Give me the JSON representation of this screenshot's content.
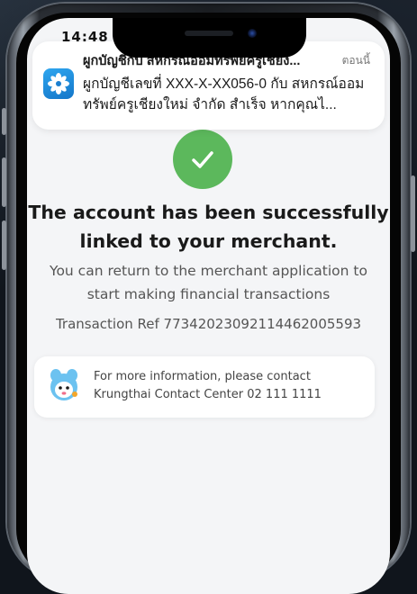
{
  "status_bar": {
    "time": "14:48"
  },
  "notification": {
    "app_icon": "krungthai-app-icon",
    "title": "ผูกบัญชีกับ สหกรณ์ออมทรัพย์ครูเชียง...",
    "time": "ตอนนี้",
    "body": "ผูกบัญชีเลขที่ XXX-X-XX056-0 กับ สหกรณ์ออมทรัพย์ครูเชียงใหม่ จำกัด สำเร็จ หากคุณไ..."
  },
  "success": {
    "icon": "checkmark-icon",
    "headline_line1": "The account has been successfully",
    "headline_line2": "linked to your merchant.",
    "subtext_line1": "You can return to the merchant application to",
    "subtext_line2": "start making financial transactions",
    "transaction_ref": "Transaction Ref 7734202309211446200559​3"
  },
  "contact": {
    "icon": "mascot-icon",
    "line1": "For more information, please contact",
    "line2": "Krungthai Contact Center 02 111 1111"
  },
  "colors": {
    "success_green": "#5cb85c",
    "app_icon_blue": "#1e8ee0"
  }
}
